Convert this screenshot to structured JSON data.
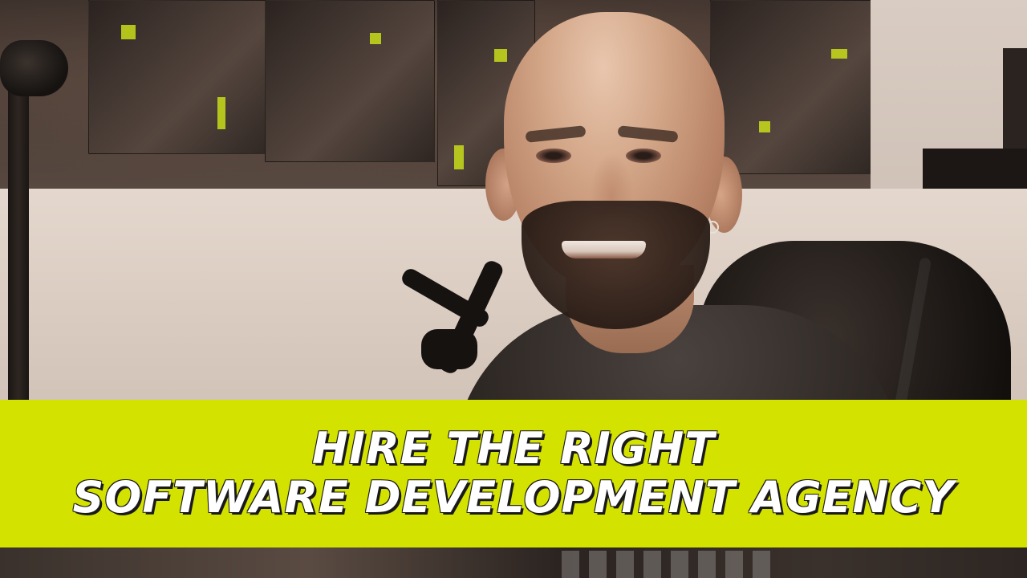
{
  "banner": {
    "line1": "HIRE THE RIGHT",
    "line2": "SOFTWARE DEVELOPMENT AGENCY",
    "background_color": "#d4e200",
    "text_color": "#ffffff",
    "outline_color": "#1a1a1a"
  },
  "scene": {
    "subject": "bald-bearded-man-smiling",
    "accent_color": "#c9dd1a"
  }
}
